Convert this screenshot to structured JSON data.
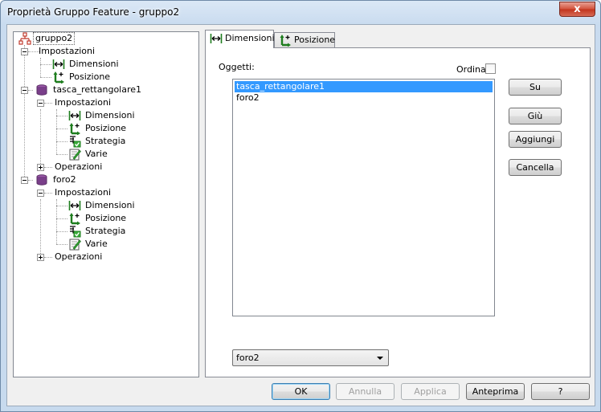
{
  "window": {
    "title": "Proprietà Gruppo Feature - gruppo2",
    "close_label": "x"
  },
  "tree": {
    "root": "gruppo2",
    "nodes": [
      {
        "label": "Impostazioni"
      },
      {
        "label": "Dimensioni"
      },
      {
        "label": "Posizione"
      },
      {
        "label": "tasca_rettangolare1"
      },
      {
        "label": "Impostazioni"
      },
      {
        "label": "Dimensioni"
      },
      {
        "label": "Posizione"
      },
      {
        "label": "Strategia"
      },
      {
        "label": "Varie"
      },
      {
        "label": "Operazioni"
      },
      {
        "label": "foro2"
      },
      {
        "label": "Impostazioni"
      },
      {
        "label": "Dimensioni"
      },
      {
        "label": "Posizione"
      },
      {
        "label": "Strategia"
      },
      {
        "label": "Varie"
      },
      {
        "label": "Operazioni"
      }
    ]
  },
  "tabs": [
    {
      "label": "Dimensioni",
      "icon": "dimension-icon",
      "active": true
    },
    {
      "label": "Posizione",
      "icon": "position-icon",
      "active": false
    }
  ],
  "panel": {
    "objects_label": "Oggetti:",
    "sort_label": "Ordina",
    "sort_checked": false,
    "list": [
      "tasca_rettangolare1",
      "foro2"
    ],
    "selected_index": 0,
    "combo_value": "foro2"
  },
  "side_buttons": {
    "up": "Su",
    "down": "Giù",
    "add": "Aggiungi",
    "delete": "Cancella"
  },
  "footer": {
    "ok": "OK",
    "cancel": "Annulla",
    "apply": "Applica",
    "preview": "Anteprima",
    "help": "?"
  },
  "colors": {
    "selection": "#3399ff",
    "icon_green": "#1e7d1e",
    "icon_red": "#c0392b"
  }
}
